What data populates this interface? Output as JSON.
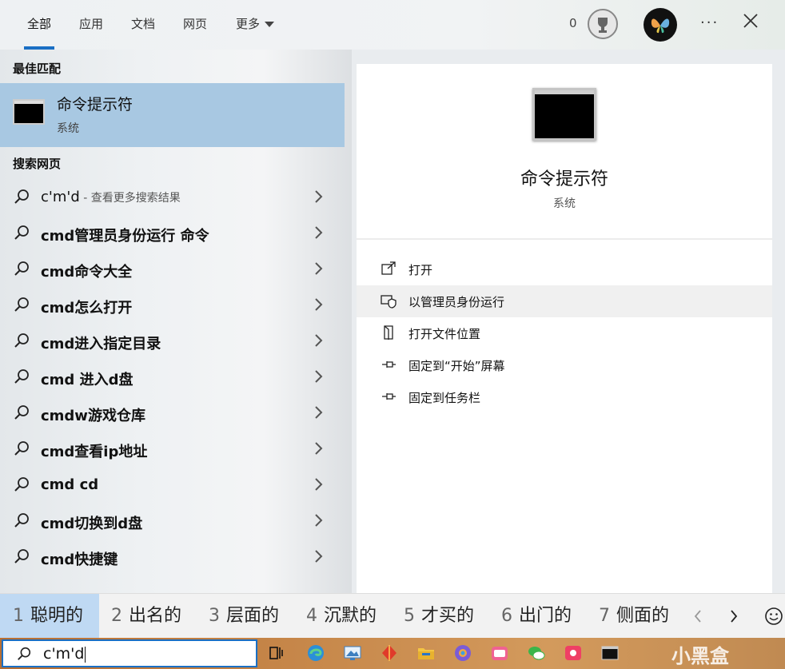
{
  "top": {
    "tabs": [
      {
        "label": "全部",
        "active": true
      },
      {
        "label": "应用"
      },
      {
        "label": "文档"
      },
      {
        "label": "网页"
      },
      {
        "label": "更多"
      }
    ],
    "points": "0",
    "more_label": "···"
  },
  "left": {
    "best_match_title": "最佳匹配",
    "best_match": {
      "name": "命令提示符",
      "sub": "系统"
    },
    "web_title": "搜索网页",
    "web_results": [
      {
        "text": "c'm'd",
        "extra": " - 查看更多搜索结果"
      },
      {
        "text": "cmd管理员身份运行 命令"
      },
      {
        "text": "cmd命令大全"
      },
      {
        "text": "cmd怎么打开"
      },
      {
        "text": "cmd进入指定目录"
      },
      {
        "text": "cmd 进入d盘"
      },
      {
        "text": "cmdw游戏仓库"
      },
      {
        "text": "cmd查看ip地址"
      },
      {
        "text": "cmd cd"
      },
      {
        "text": "cmd切换到d盘"
      },
      {
        "text": "cmd快捷键"
      }
    ]
  },
  "right": {
    "title": "命令提示符",
    "sub": "系统",
    "actions": [
      {
        "label": "打开",
        "icon": "open-icon"
      },
      {
        "label": "以管理员身份运行",
        "icon": "shield-admin-icon"
      },
      {
        "label": "打开文件位置",
        "icon": "folder-location-icon"
      },
      {
        "label": "固定到“开始”屏幕",
        "icon": "pin-icon"
      },
      {
        "label": "固定到任务栏",
        "icon": "pin-icon"
      }
    ]
  },
  "ime": {
    "candidates": [
      {
        "num": "1",
        "word": "聪明的"
      },
      {
        "num": "2",
        "word": "出名的"
      },
      {
        "num": "3",
        "word": "层面的"
      },
      {
        "num": "4",
        "word": "沉默的"
      },
      {
        "num": "5",
        "word": "才买的"
      },
      {
        "num": "6",
        "word": "出门的"
      },
      {
        "num": "7",
        "word": "侧面的"
      }
    ]
  },
  "taskbar": {
    "search_value": "c'm'd",
    "watermark": "小黑盒"
  },
  "colors": {
    "accent": "#1a6fc4",
    "selection": "#a8c8e2",
    "ime_selected": "#bfd9f3"
  }
}
